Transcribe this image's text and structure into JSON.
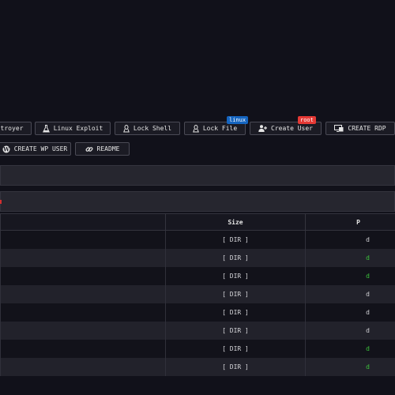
{
  "toolbar": {
    "row1": [
      {
        "label": "troyer",
        "icon": "destroy-icon"
      },
      {
        "label": "Linux Exploit",
        "icon": "flask-icon"
      },
      {
        "label": "Lock Shell",
        "icon": "linux-tux-icon"
      },
      {
        "label": "Lock File",
        "icon": "linux-tux-icon",
        "badge": "linux",
        "badge_color": "#1565c0"
      },
      {
        "label": "Create User",
        "icon": "user-plus-icon",
        "badge": "root",
        "badge_color": "#e53935"
      },
      {
        "label": "CREATE RDP",
        "icon": "monitor-icon"
      }
    ],
    "row2": [
      {
        "label": "CREATE WP USER",
        "icon": "wordpress-icon"
      },
      {
        "label": "README",
        "icon": "link-icon"
      }
    ]
  },
  "file_table": {
    "headers": [
      "",
      "Size",
      "P"
    ],
    "rows": [
      {
        "size": "[ DIR ]",
        "perm": "d",
        "perm_color": "#d4d4d8"
      },
      {
        "size": "[ DIR ]",
        "perm": "d",
        "perm_color": "#3cc43c"
      },
      {
        "size": "[ DIR ]",
        "perm": "d",
        "perm_color": "#3cc43c"
      },
      {
        "size": "[ DIR ]",
        "perm": "d",
        "perm_color": "#d4d4d8"
      },
      {
        "size": "[ DIR ]",
        "perm": "d",
        "perm_color": "#d4d4d8"
      },
      {
        "size": "[ DIR ]",
        "perm": "d",
        "perm_color": "#d4d4d8"
      },
      {
        "size": "[ DIR ]",
        "perm": "d",
        "perm_color": "#3cc43c"
      },
      {
        "size": "[ DIR ]",
        "perm": "d",
        "perm_color": "#3cc43c"
      }
    ]
  },
  "colors": {
    "background": "#11111a",
    "error_accent": "#d32f2f",
    "permission_green": "#3cc43c"
  }
}
